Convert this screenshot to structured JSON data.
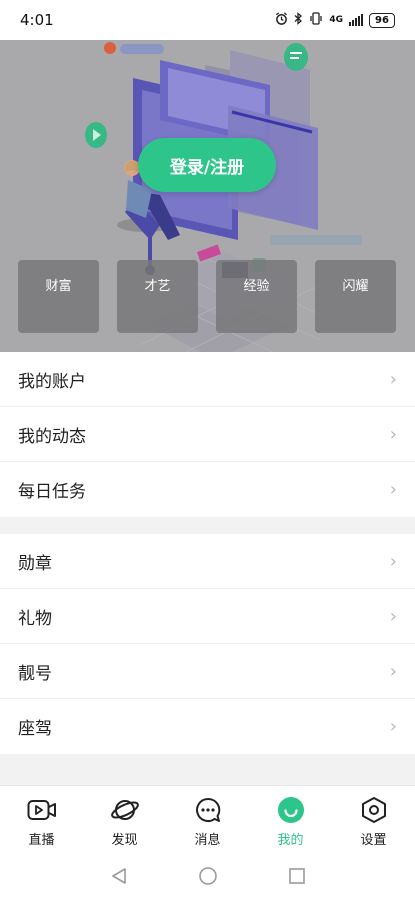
{
  "status_bar": {
    "time": "4:01",
    "network": "4G",
    "battery": "96"
  },
  "hero": {
    "login_button": "登录/注册",
    "stats": [
      "财富",
      "才艺",
      "经验",
      "闪耀"
    ]
  },
  "menu_groups": [
    [
      "我的账户",
      "我的动态",
      "每日任务"
    ],
    [
      "勋章",
      "礼物",
      "靓号",
      "座驾"
    ]
  ],
  "tabs": [
    {
      "label": "直播",
      "icon": "video-icon"
    },
    {
      "label": "发现",
      "icon": "planet-icon"
    },
    {
      "label": "消息",
      "icon": "chat-bubble-icon"
    },
    {
      "label": "我的",
      "icon": "smile-face-icon"
    },
    {
      "label": "设置",
      "icon": "settings-hexagon-icon"
    }
  ],
  "active_tab_index": 3,
  "colors": {
    "accent": "#2ec58a",
    "hero_overlay": "#a9a9ab",
    "background": "#f2f2f2"
  }
}
